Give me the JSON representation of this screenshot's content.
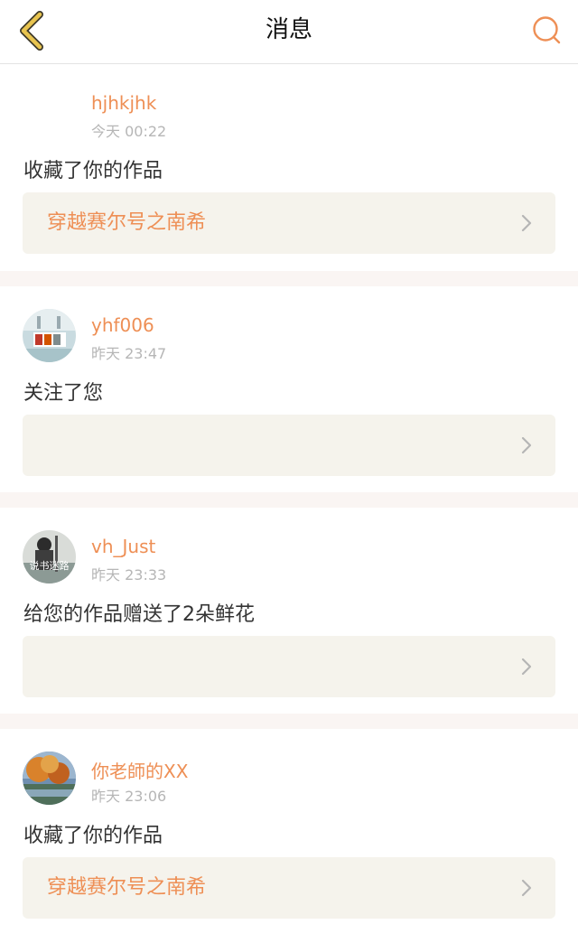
{
  "header": {
    "title": "消息",
    "back_icon": "chevron-left-icon",
    "search_icon": "search-icon",
    "accent_color": "#ee8f55",
    "back_color": "#e8c44f"
  },
  "notifications": [
    {
      "user": "hjhkjhk",
      "time": "今天 00:22",
      "action": "收藏了你的作品",
      "work_title": "穿越赛尔号之南希"
    },
    {
      "user": "yhf006",
      "time": "昨天 23:47",
      "action": "关注了您",
      "work_title": ""
    },
    {
      "user": "vh_Just",
      "time": "昨天 23:33",
      "action": "给您的作品赠送了2朵鲜花",
      "work_title": "",
      "avatar_text": "说书迷路"
    },
    {
      "user": "你老師的XX",
      "time": "昨天 23:06",
      "action": "收藏了你的作品",
      "work_title": "穿越赛尔号之南希"
    }
  ]
}
